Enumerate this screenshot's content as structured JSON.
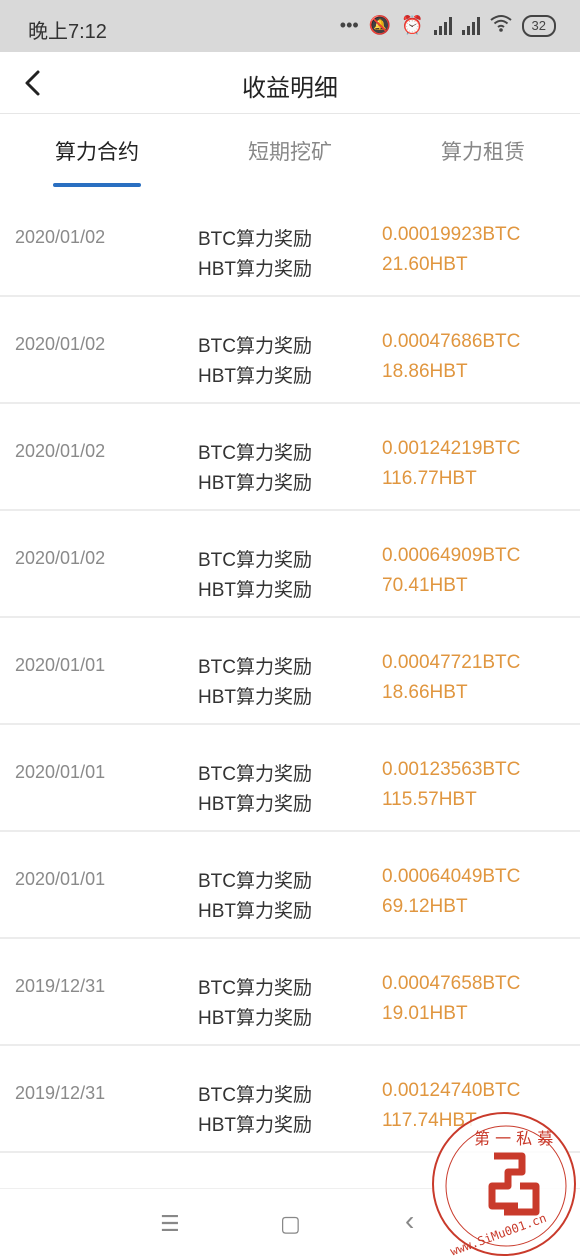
{
  "status_bar": {
    "time": "晚上7:12",
    "battery": "32"
  },
  "header": {
    "title": "收益明细"
  },
  "tabs": [
    {
      "label": "算力合约",
      "active": true
    },
    {
      "label": "短期挖矿",
      "active": false
    },
    {
      "label": "算力租赁",
      "active": false
    }
  ],
  "rows": [
    {
      "date": "2020/01/02",
      "label_btc": "BTC算力奖励",
      "label_hbt": "HBT算力奖励",
      "btc": "0.00019923BTC",
      "hbt": "21.60HBT"
    },
    {
      "date": "2020/01/02",
      "label_btc": "BTC算力奖励",
      "label_hbt": "HBT算力奖励",
      "btc": "0.00047686BTC",
      "hbt": "18.86HBT"
    },
    {
      "date": "2020/01/02",
      "label_btc": "BTC算力奖励",
      "label_hbt": "HBT算力奖励",
      "btc": "0.00124219BTC",
      "hbt": "116.77HBT"
    },
    {
      "date": "2020/01/02",
      "label_btc": "BTC算力奖励",
      "label_hbt": "HBT算力奖励",
      "btc": "0.00064909BTC",
      "hbt": "70.41HBT"
    },
    {
      "date": "2020/01/01",
      "label_btc": "BTC算力奖励",
      "label_hbt": "HBT算力奖励",
      "btc": "0.00047721BTC",
      "hbt": "18.66HBT"
    },
    {
      "date": "2020/01/01",
      "label_btc": "BTC算力奖励",
      "label_hbt": "HBT算力奖励",
      "btc": "0.00123563BTC",
      "hbt": "115.57HBT"
    },
    {
      "date": "2020/01/01",
      "label_btc": "BTC算力奖励",
      "label_hbt": "HBT算力奖励",
      "btc": "0.00064049BTC",
      "hbt": "69.12HBT"
    },
    {
      "date": "2019/12/31",
      "label_btc": "BTC算力奖励",
      "label_hbt": "HBT算力奖励",
      "btc": "0.00047658BTC",
      "hbt": "19.01HBT"
    },
    {
      "date": "2019/12/31",
      "label_btc": "BTC算力奖励",
      "label_hbt": "HBT算力奖励",
      "btc": "0.00124740BTC",
      "hbt": "117.74HBT"
    }
  ],
  "nav_bar": {
    "menu_icon": "☰",
    "home_icon": "▢",
    "back_icon": "‹"
  },
  "watermark": {
    "text_top": "第一私募",
    "text_bottom": "www.SiMu001.cn"
  },
  "colors": {
    "accent": "#2a6fc1",
    "value": "#e0963f",
    "stamp": "#c93a2b"
  }
}
